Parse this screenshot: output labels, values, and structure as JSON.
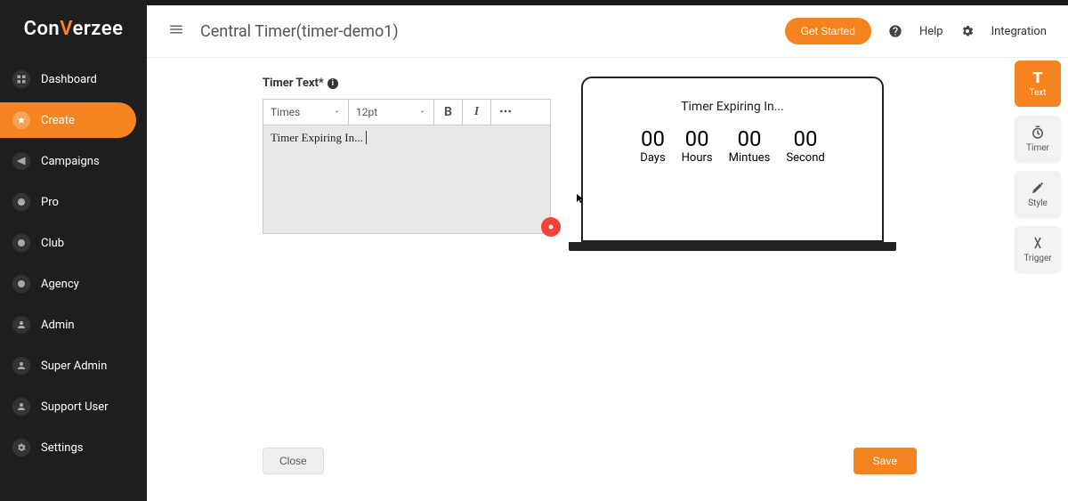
{
  "logo": {
    "pre": "Con",
    "mid": "V",
    "post": "erzee"
  },
  "sidebar": {
    "items": [
      {
        "label": "Dashboard"
      },
      {
        "label": "Create"
      },
      {
        "label": "Campaigns"
      },
      {
        "label": "Pro"
      },
      {
        "label": "Club"
      },
      {
        "label": "Agency"
      },
      {
        "label": "Admin"
      },
      {
        "label": "Super Admin"
      },
      {
        "label": "Support User"
      },
      {
        "label": "Settings"
      }
    ]
  },
  "header": {
    "title": "Central Timer(timer-demo1)",
    "get_started": "Get Started",
    "help": "Help",
    "integration": "Integration"
  },
  "editor": {
    "label": "Timer Text*",
    "font_family": "Times",
    "font_size": "12pt",
    "content": "Timer Expiring In...",
    "bold_label": "B",
    "italic_label": "I"
  },
  "preview": {
    "title": "Timer Expiring In...",
    "cols": [
      {
        "num": "00",
        "label": "Days"
      },
      {
        "num": "00",
        "label": "Hours"
      },
      {
        "num": "00",
        "label": "Mintues"
      },
      {
        "num": "00",
        "label": "Second"
      }
    ]
  },
  "side_tabs": [
    {
      "label": "Text"
    },
    {
      "label": "Timer"
    },
    {
      "label": "Style"
    },
    {
      "label": "Trigger"
    }
  ],
  "footer": {
    "close": "Close",
    "save": "Save"
  }
}
